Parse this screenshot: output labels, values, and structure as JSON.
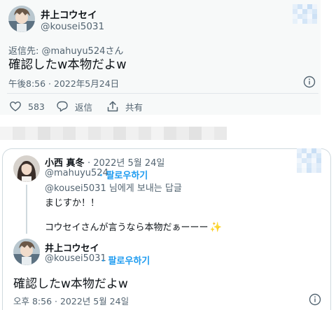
{
  "top_tweet": {
    "author_name": "井上コウセイ",
    "author_handle": "@kousei5031",
    "avatar_icon": "anime-avatar-icon",
    "reply_to": "返信先: @mahuyu524さん",
    "text": "確認したw本物だよw",
    "timestamp": "午後8:56 · 2022年5月24日",
    "actions": {
      "like_count": "583",
      "reply_label": "返信",
      "share_label": "共有"
    }
  },
  "bottom_thread": {
    "reply_tweet": {
      "author_name": "小西 真冬",
      "date": "· 2022년 5월 24일",
      "author_handle": "@mahuyu524",
      "follow_label": "· 팔로우하기",
      "reply_to": "@kousei5031 님에게 보내는 답글",
      "line1": "まじすか！！",
      "line2": "コウセイさんが言うなら本物だぁーーー",
      "sparkle": "✨"
    },
    "quoted_tweet": {
      "author_name": "井上コウセイ",
      "author_handle": "@kousei5031",
      "follow_label": "· 팔로우하기",
      "text": "確認したw本物だよw",
      "timestamp": "오후 8:56 · 2022년 5월 24일"
    }
  },
  "colors": {
    "accent": "#1d9bf0",
    "secondary_text": "#536471",
    "top_card_bg": "#f7f9f9"
  }
}
